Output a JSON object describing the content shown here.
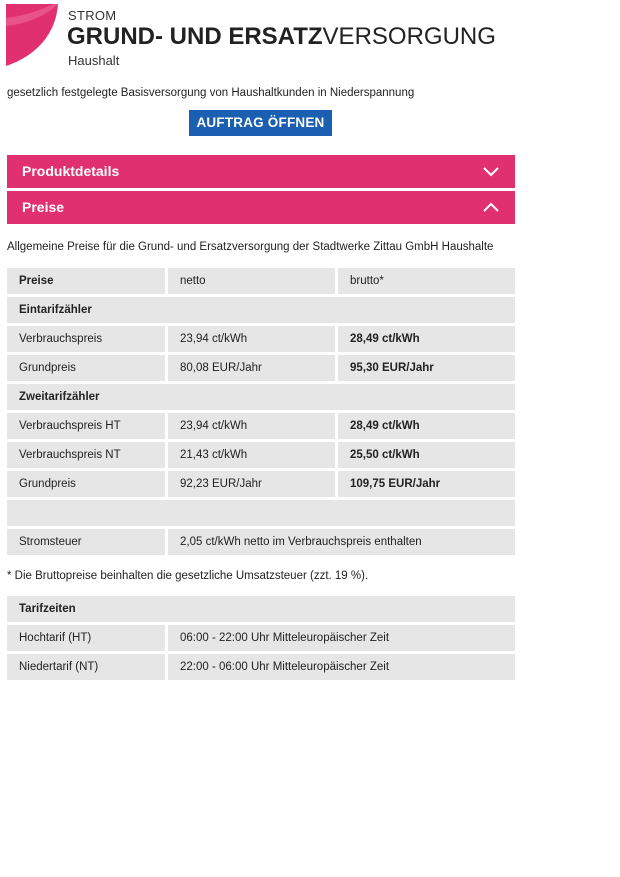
{
  "header": {
    "small_label": "STROM",
    "title_bold": "GRUND- UND ERSATZ",
    "title_regular": "VERSORGUNG",
    "subtitle": "Haushalt",
    "logo_icon": "pink-wave-logo",
    "brand_color": "#e0306f"
  },
  "intro": "gesetzlich festgelegte Basisversorgung von Haushaltkunden in Niederspannung",
  "order_button": {
    "label": "AUFTRAG ÖFFNEN",
    "color": "#1a5fb0"
  },
  "accordion": {
    "product_details": {
      "label": "Produktdetails",
      "state": "collapsed",
      "icon": "chevron-down-icon"
    },
    "prices": {
      "label": "Preise",
      "state": "expanded",
      "icon": "chevron-up-icon"
    }
  },
  "prices_description": "Allgemeine Preise für die Grund- und Ersatzversorgung der Stadtwerke Zittau GmbH Haushalte",
  "price_table": {
    "headers": [
      "Preise",
      "netto",
      "brutto*"
    ],
    "sections": {
      "single": "Eintarifzähler",
      "dual": "Zweitarifzähler"
    },
    "single_rows": [
      [
        "Verbrauchspreis",
        "23,94 ct/kWh",
        "28,49 ct/kWh"
      ],
      [
        "Grundpreis",
        "80,08 EUR/Jahr",
        "95,30 EUR/Jahr"
      ]
    ],
    "dual_rows": [
      [
        "Verbrauchspreis HT",
        "23,94 ct/kWh",
        "28,49 ct/kWh"
      ],
      [
        "Verbrauchspreis NT",
        "21,43 ct/kWh",
        "25,50 ct/kWh"
      ],
      [
        "Grundpreis",
        "92,23 EUR/Jahr",
        "109,75 EUR/Jahr"
      ]
    ],
    "tax_row": [
      "Stromsteuer",
      "2,05 ct/kWh netto im Verbrauchspreis enthalten"
    ]
  },
  "footnote": "* Die Bruttopreise beinhalten die gesetzliche Umsatzsteuer (zzt. 19 %).",
  "tariff_times": {
    "header": "Tarifzeiten",
    "rows": [
      [
        "Hochtarif (HT)",
        "06:00 - 22:00 Uhr Mitteleuropäischer Zeit"
      ],
      [
        "Niedertarif (NT)",
        "22:00 - 06:00 Uhr Mitteleuropäischer Zeit"
      ]
    ]
  }
}
